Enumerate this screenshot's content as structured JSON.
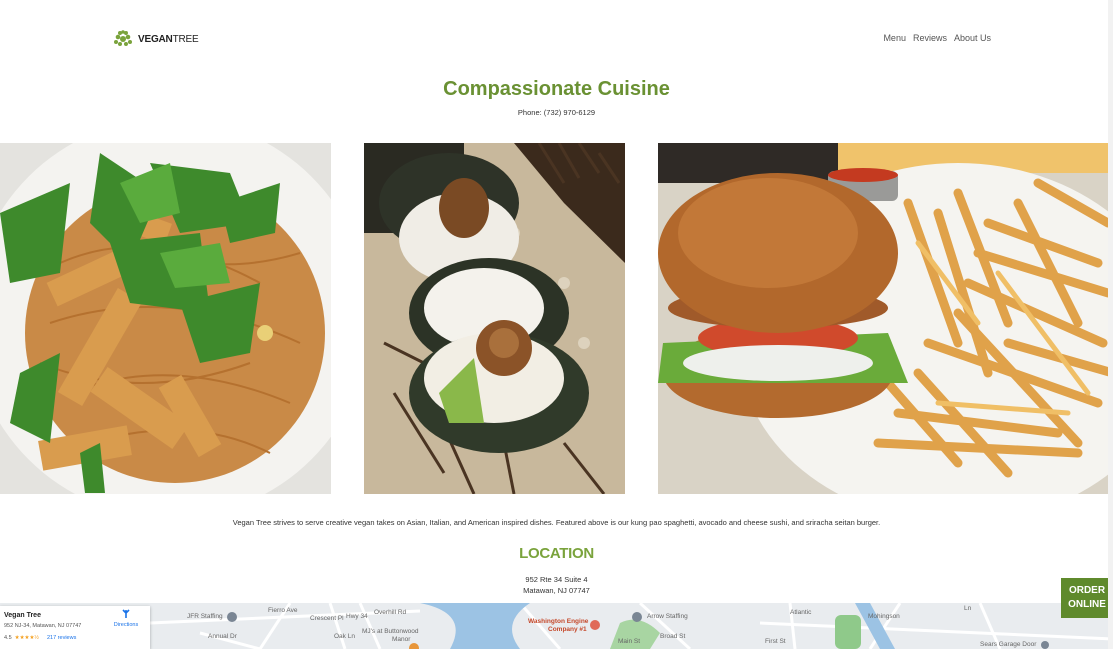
{
  "header": {
    "logo_bold": "VEGAN",
    "logo_light": "TREE",
    "nav": [
      {
        "label": "Menu"
      },
      {
        "label": "Reviews"
      },
      {
        "label": "About Us"
      }
    ]
  },
  "hero": {
    "title": "Compassionate Cuisine",
    "phone": "Phone: (732) 970-6129"
  },
  "photos": [
    {
      "icon": "kung-pao-spaghetti-photo"
    },
    {
      "icon": "avocado-cheese-sushi-photo"
    },
    {
      "icon": "sriracha-seitan-burger-photo"
    }
  ],
  "description": "Vegan Tree strives to serve creative vegan takes on Asian, Italian, and American inspired dishes. Featured above is our kung pao spaghetti, avocado and cheese sushi, and sriracha seitan burger.",
  "location": {
    "title": "LOCATION",
    "line1": "952 Rte 34 Suite 4",
    "line2": "Matawan, NJ 07747"
  },
  "map": {
    "place_name": "Vegan Tree",
    "place_address": "952 NJ-34, Matawan, NJ 07747",
    "rating": "4.5",
    "stars": "★★★★½",
    "reviews": "217 reviews",
    "directions": "Directions",
    "labels": {
      "jfr": "JFR Staffing",
      "mjs": "MJ's at Buttonwood",
      "manor": "Manor",
      "washington": "Washington Engine",
      "company": "Company #1",
      "arrow": "Arrow Staffing",
      "sears": "Sears Garage Door",
      "first": "First St",
      "hwy": "Hwy 34",
      "main": "Main St",
      "broad": "Broad St",
      "crescent": "Crescent Pl",
      "annual": "Annual Dr",
      "fierro": "Fierro Ave",
      "oak": "Oak Ln",
      "overhill": "Overhill Rd",
      "atlantic": "Atlantic",
      "mohingson": "Mohingson",
      "ln": "Ln"
    }
  },
  "order_button": {
    "line1": "ORDER",
    "line2": "ONLINE"
  },
  "colors": {
    "accent": "#6a9133",
    "button": "#5f8a2c"
  }
}
